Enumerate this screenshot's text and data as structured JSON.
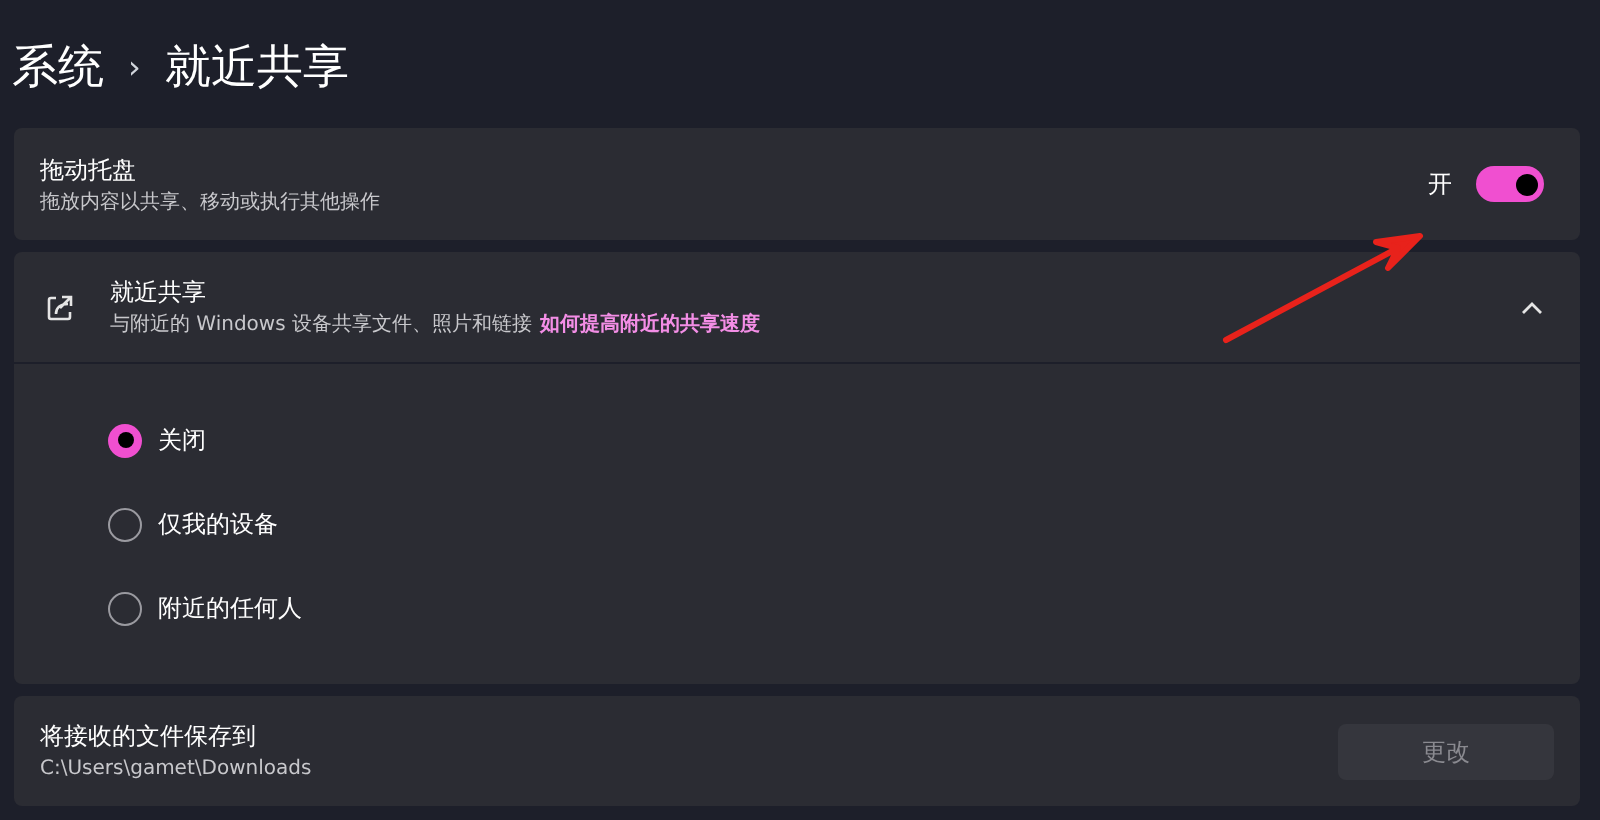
{
  "breadcrumb": {
    "parent": "系统",
    "separator": "›",
    "current": "就近共享"
  },
  "drag_tray": {
    "title": "拖动托盘",
    "description": "拖放内容以共享、移动或执行其他操作",
    "toggle_label": "开",
    "on": true
  },
  "nearby_sharing": {
    "title": "就近共享",
    "description": "与附近的 Windows 设备共享文件、照片和链接",
    "link": "如何提高附近的共享速度",
    "expanded": true,
    "options": [
      {
        "label": "关闭",
        "selected": true
      },
      {
        "label": "仅我的设备",
        "selected": false
      },
      {
        "label": "附近的任何人",
        "selected": false
      }
    ]
  },
  "save_location": {
    "title": "将接收的文件保存到",
    "path": "C:\\Users\\gamet\\Downloads",
    "button": {
      "label": "更改",
      "disabled": true
    }
  }
}
